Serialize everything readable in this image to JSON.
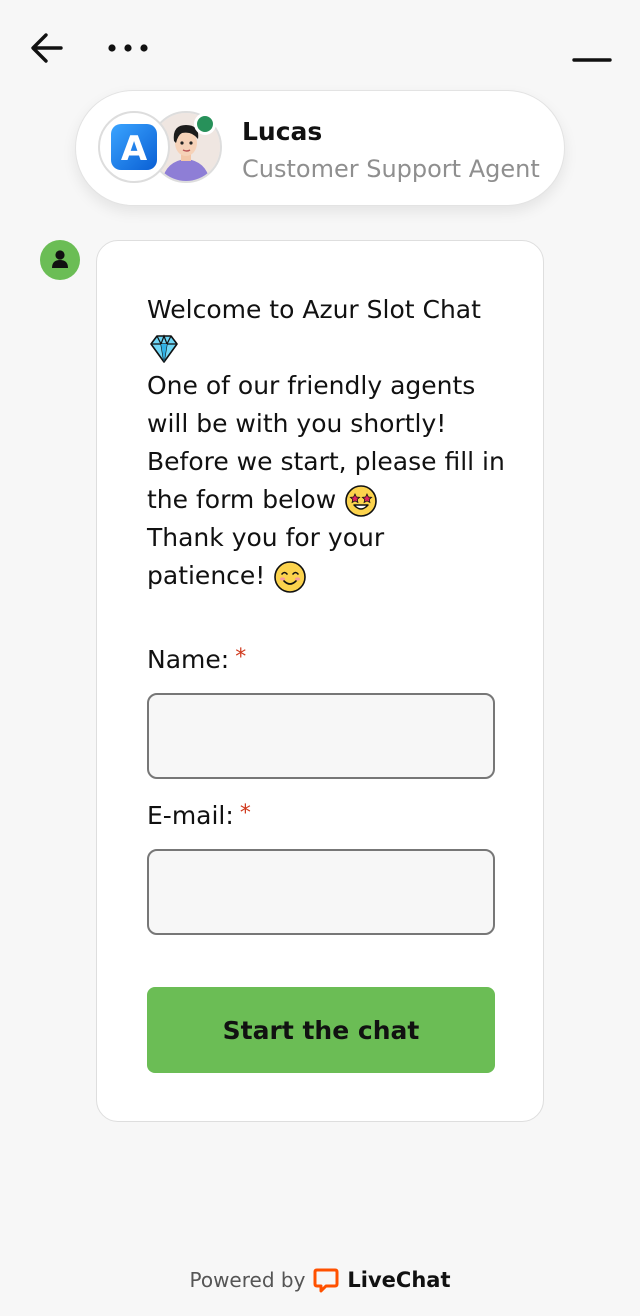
{
  "header": {
    "agent_name": "Lucas",
    "agent_role": "Customer Support Agent",
    "logo_letter": "A"
  },
  "message": {
    "lines": [
      "Welcome to Azur Slot Chat",
      "One of our friendly agents will be with you shortly!",
      "Before we start, please fill in the form below",
      "Thank you for your patience!"
    ],
    "emojis": [
      "gem-emoji",
      "star-struck-emoji",
      "smiling-face-emoji"
    ]
  },
  "form": {
    "name_label": "Name:",
    "email_label": "E-mail:",
    "required_mark": "*",
    "name_value": "",
    "email_value": "",
    "submit_label": "Start the chat"
  },
  "footer": {
    "powered_by": "Powered by",
    "brand": "LiveChat"
  },
  "colors": {
    "accent_green": "#6bbd55",
    "online_green": "#27915a",
    "required_red": "#d0391d",
    "brand_orange": "#ff5100"
  }
}
